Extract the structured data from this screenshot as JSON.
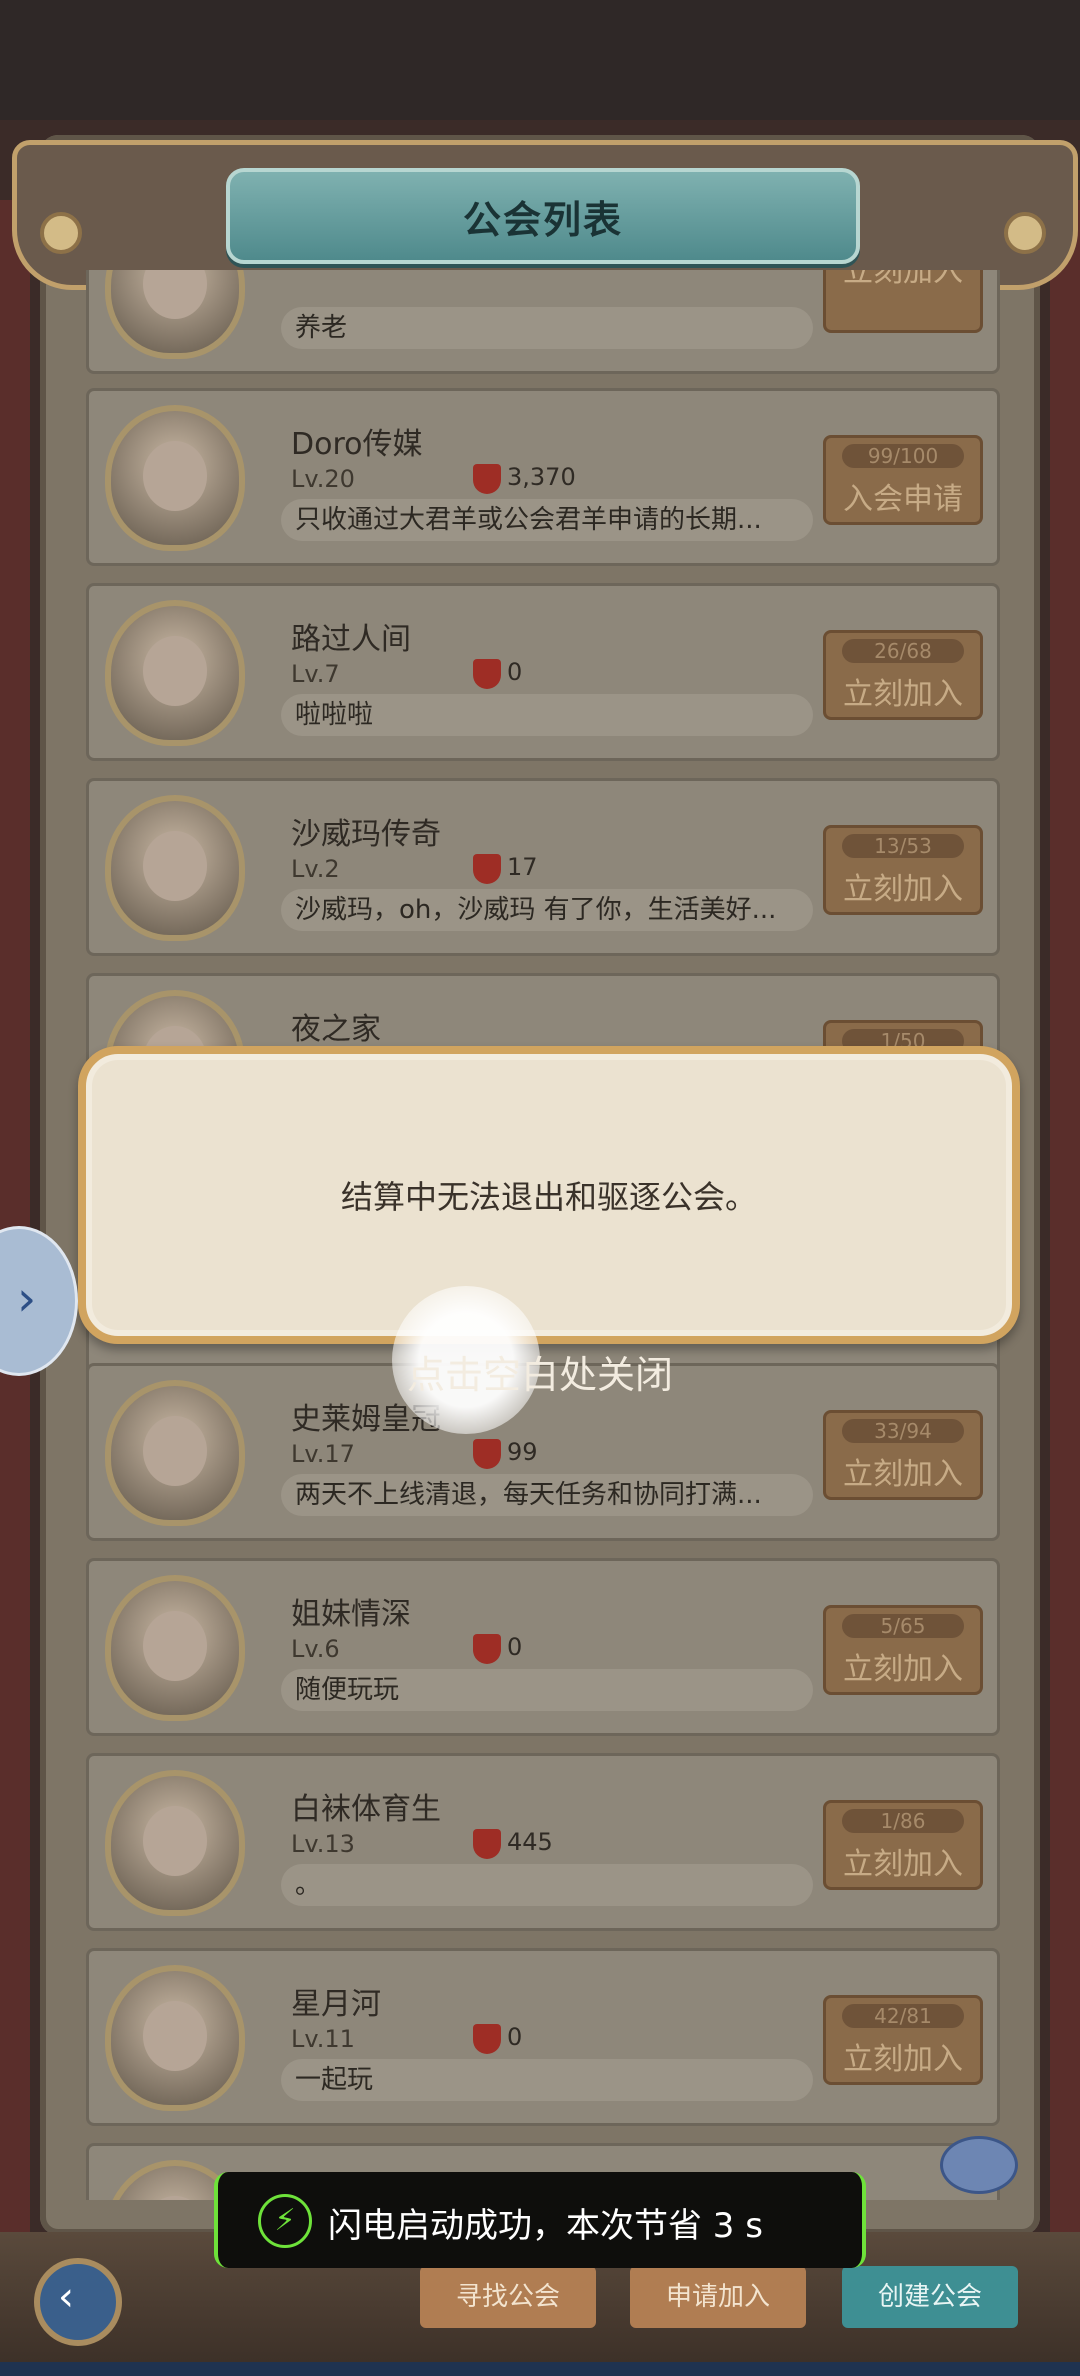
{
  "header": {
    "title": "公会列表"
  },
  "guilds": [
    {
      "name": "",
      "level": "",
      "points": "",
      "motto": "养老",
      "count": "",
      "join_label": "立刻加入"
    },
    {
      "name": "Doro传媒",
      "level": "Lv.20",
      "points": "3,370",
      "motto": "只收通过大君羊或公会君羊申请的长期...",
      "count": "99/100",
      "join_label": "入会申请"
    },
    {
      "name": "路过人间",
      "level": "Lv.7",
      "points": "0",
      "motto": "啦啦啦",
      "count": "26/68",
      "join_label": "立刻加入"
    },
    {
      "name": "沙威玛传奇",
      "level": "Lv.2",
      "points": "17",
      "motto": "沙威玛，oh，沙威玛 有了你，生活美好...",
      "count": "13/53",
      "join_label": "立刻加入"
    },
    {
      "name": "夜之家",
      "level": "",
      "points": "",
      "motto": "",
      "count": "1/50",
      "join_label": ""
    },
    {
      "name": "史莱姆皇冠",
      "level": "Lv.17",
      "points": "99",
      "motto": "两天不上线清退，每天任务和协同打满...",
      "count": "33/94",
      "join_label": "立刻加入"
    },
    {
      "name": "姐妹情深",
      "level": "Lv.6",
      "points": "0",
      "motto": "随便玩玩",
      "count": "5/65",
      "join_label": "立刻加入"
    },
    {
      "name": "白袜体育生",
      "level": "Lv.13",
      "points": "445",
      "motto": "。",
      "count": "1/86",
      "join_label": "立刻加入"
    },
    {
      "name": "星月河",
      "level": "Lv.11",
      "points": "0",
      "motto": "一起玩",
      "count": "42/81",
      "join_label": "立刻加入"
    }
  ],
  "dialog": {
    "message": "结算中无法退出和驱逐公会。",
    "close_hint": "点击空白处关闭"
  },
  "toast": {
    "text": "闪电启动成功，本次节省 3 s"
  },
  "bottom_tabs": {
    "find": "寻找公会",
    "apply": "申请加入",
    "create": "创建公会"
  },
  "icons": {
    "side": "chevron-right-icon",
    "back": "back-arrow-icon",
    "toast": "lightning-icon"
  },
  "colors": {
    "accent": "#6ee23a",
    "title_banner": "#5f9a9b",
    "join_button": "#8a6b4a"
  }
}
